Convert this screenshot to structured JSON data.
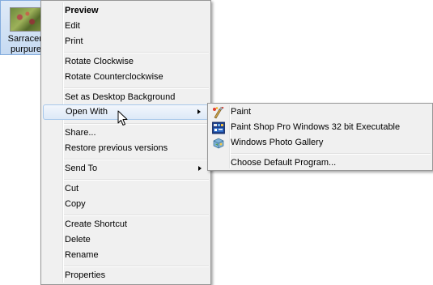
{
  "file": {
    "name_line1": "Sarracen",
    "name_line2": "purpure",
    "thumbnail_icon": "image-thumbnail-icon"
  },
  "context_menu": {
    "items": [
      {
        "label": "Preview",
        "bold": true
      },
      {
        "label": "Edit"
      },
      {
        "label": "Print"
      },
      {
        "label": "Rotate Clockwise"
      },
      {
        "label": "Rotate Counterclockwise"
      },
      {
        "label": "Set as Desktop Background"
      },
      {
        "label": "Open With",
        "submenu": true,
        "highlighted": true
      },
      {
        "label": "Share..."
      },
      {
        "label": "Restore previous versions"
      },
      {
        "label": "Send To",
        "submenu": true
      },
      {
        "label": "Cut"
      },
      {
        "label": "Copy"
      },
      {
        "label": "Create Shortcut"
      },
      {
        "label": "Delete"
      },
      {
        "label": "Rename"
      },
      {
        "label": "Properties"
      }
    ]
  },
  "open_with_submenu": {
    "items": [
      {
        "label": "Paint",
        "icon": "paint-icon"
      },
      {
        "label": "Paint Shop Pro Windows 32 bit Executable",
        "icon": "paint-shop-pro-icon"
      },
      {
        "label": "Windows Photo Gallery",
        "icon": "photo-gallery-icon"
      },
      {
        "label": "Choose Default Program..."
      }
    ]
  },
  "colors": {
    "menu_background": "#f0f0f0",
    "menu_border": "#979797",
    "highlight_border": "#a8c8eb",
    "file_selection": "#c6daf2"
  }
}
